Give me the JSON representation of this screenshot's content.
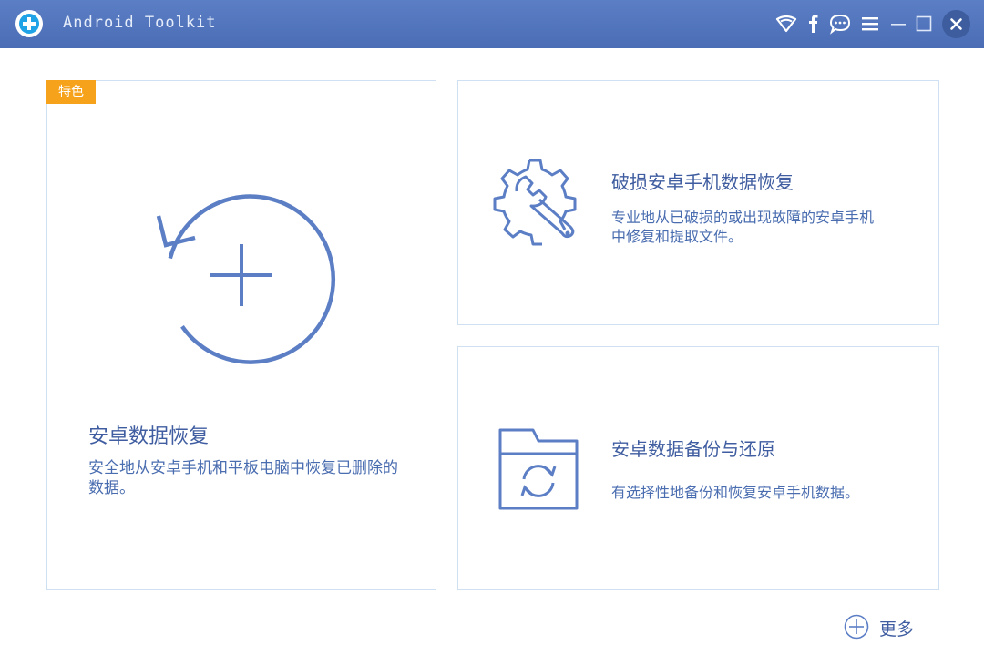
{
  "window": {
    "title": "Android Toolkit",
    "controls": [
      "wifi-icon",
      "facebook-icon",
      "feedback-icon",
      "menu-icon",
      "minimize-icon",
      "maximize-icon",
      "close-icon"
    ]
  },
  "colors": {
    "titlebar": "#5576be",
    "accent": "#5b7ec5",
    "text": "#3f5da0",
    "card_border": "#cfe0f3",
    "badge": "#f7a21b"
  },
  "cards": {
    "recovery": {
      "badge": "特色",
      "title": "安卓数据恢复",
      "description": "安全地从安卓手机和平板电脑中恢复已删除的数据。"
    },
    "broken": {
      "title": "破损安卓手机数据恢复",
      "description": "专业地从已破损的或出现故障的安卓手机中修复和提取文件。"
    },
    "backup": {
      "title": "安卓数据备份与还原",
      "description": "有选择性地备份和恢复安卓手机数据。"
    }
  },
  "more": {
    "label": "更多"
  }
}
